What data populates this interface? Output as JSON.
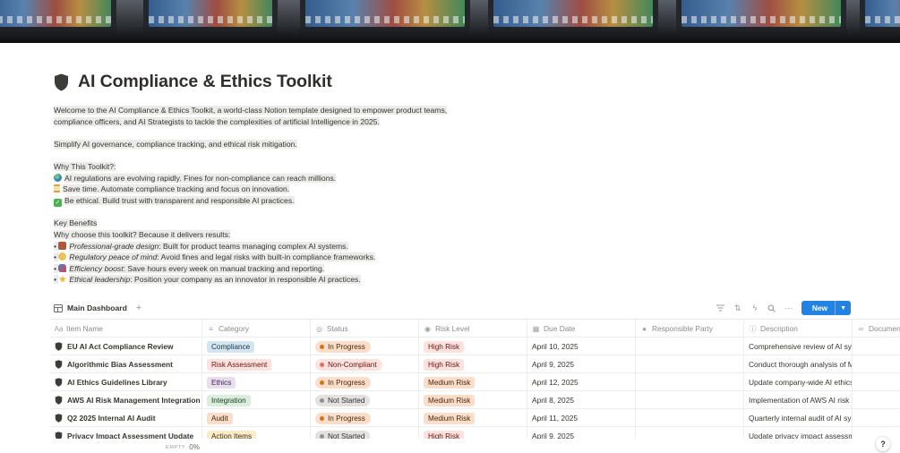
{
  "page": {
    "title": "AI Compliance & Ethics Toolkit",
    "icon": "shield-icon"
  },
  "intro": {
    "line1": "Welcome to the AI Compliance & Ethics Toolkit, a world-class Notion template designed to empower product teams,",
    "line2": "compliance officers, and AI Strategists to tackle the complexities of artificial Intelligence in 2025.",
    "tagline": "Simplify AI governance, compliance tracking, and ethical risk mitigation."
  },
  "why": {
    "heading": "Why This Toolkit?:",
    "items": [
      {
        "icon": "globe-icon",
        "text": "AI regulations are evolving rapidly. Fines for non-compliance can reach millions."
      },
      {
        "icon": "hourglass-icon",
        "text": "Save time. Automate compliance tracking and focus on innovation."
      },
      {
        "icon": "check-icon",
        "text": "Be ethical. Build trust with transparent and responsible AI practices."
      }
    ]
  },
  "benefits": {
    "heading": "Key Benefits",
    "subheading": "Why choose this toolkit? Because it delivers results:",
    "items": [
      {
        "icon": "briefcase-icon",
        "label": "Professional-grade design",
        "text": ": Built for product teams managing complex AI systems."
      },
      {
        "icon": "peace-icon",
        "label": "Regulatory peace of mind",
        "text": ": Avoid fines and legal risks with built-in compliance frameworks."
      },
      {
        "icon": "rocket-icon",
        "label": "Efficiency boost",
        "text": ": Save hours every week on manual tracking and reporting."
      },
      {
        "icon": "star-icon",
        "label": "Ethical leadership",
        "text": ": Position your company as an innovator in responsible AI practices."
      }
    ]
  },
  "database": {
    "view_name": "Main Dashboard",
    "add_view": "+",
    "new_label": "New",
    "columns": [
      {
        "label": "Item Name",
        "icon": "Aa"
      },
      {
        "label": "Category",
        "icon": "≡"
      },
      {
        "label": "Status",
        "icon": "◎"
      },
      {
        "label": "Risk Level",
        "icon": "◉"
      },
      {
        "label": "Due Date",
        "icon": "▦"
      },
      {
        "label": "Responsible Party",
        "icon": "●"
      },
      {
        "label": "Description",
        "icon": "ⓘ"
      },
      {
        "label": "Documen",
        "icon": "∞"
      }
    ],
    "rows": [
      {
        "name": "EU AI Act Compliance Review",
        "category": "Compliance",
        "cat_color": "blue",
        "status": "In Progress",
        "status_color": "orange",
        "risk": "High Risk",
        "risk_color": "red",
        "due": "April 10, 2025",
        "party": "",
        "desc": "Comprehensive review of AI sys"
      },
      {
        "name": "Algorithmic Bias Assessment",
        "category": "Risk Assessment",
        "cat_color": "red",
        "status": "Non-Compliant",
        "status_color": "red",
        "risk": "High Risk",
        "risk_color": "red",
        "due": "April 9, 2025",
        "party": "",
        "desc": "Conduct thorough analysis of M"
      },
      {
        "name": "AI Ethics Guidelines Library",
        "category": "Ethics",
        "cat_color": "purple",
        "status": "In Progress",
        "status_color": "orange",
        "risk": "Medium Risk",
        "risk_color": "orange",
        "due": "April 12, 2025",
        "party": "",
        "desc": "Update company-wide AI ethics"
      },
      {
        "name": "AWS AI Risk Management Integration",
        "category": "Integration",
        "cat_color": "green",
        "status": "Not Started",
        "status_color": "gray",
        "risk": "Medium Risk",
        "risk_color": "orange",
        "due": "April 8, 2025",
        "party": "",
        "desc": "Implementation of AWS AI risk m"
      },
      {
        "name": "Q2 2025 Internal AI Audit",
        "category": "Audit",
        "cat_color": "orange",
        "status": "In Progress",
        "status_color": "orange",
        "risk": "Medium Risk",
        "risk_color": "orange",
        "due": "April 11, 2025",
        "party": "",
        "desc": "Quarterly internal audit of AI sy"
      },
      {
        "name": "Privacy Impact Assessment Update",
        "category": "Action Items",
        "cat_color": "yellow",
        "status": "Not Started",
        "status_color": "gray",
        "risk": "High Risk",
        "risk_color": "red",
        "due": "April 9, 2025",
        "party": "",
        "desc": "Update privacy impact assessm"
      }
    ]
  },
  "footer": {
    "label": "EMPTY",
    "value": "0%"
  },
  "help_label": "?",
  "colors": {
    "accent": "#2383e2",
    "tag_blue": "#d3e5ef",
    "tag_red": "#ffe2dd",
    "tag_purple": "#e8deee",
    "tag_green": "#dbeddb",
    "tag_orange": "#fadec9",
    "tag_yellow": "#fdecc8",
    "tag_gray": "#e3e2e0"
  }
}
